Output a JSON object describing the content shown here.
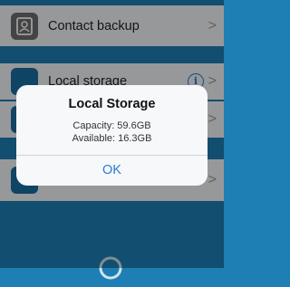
{
  "list": {
    "items": [
      {
        "label": "Contact backup",
        "icon": "contact-book-icon"
      },
      {
        "label": "Local storage",
        "icon": "folder-icon"
      },
      {
        "label": "",
        "icon": "shield-icon"
      },
      {
        "label": "",
        "icon": "checkbox-icon"
      }
    ],
    "info_glyph": "i",
    "chevron": ">"
  },
  "dialog": {
    "title": "Local Storage",
    "capacity": "Capacity: 59.6GB",
    "available": "Available: 16.3GB",
    "ok_label": "OK"
  },
  "colors": {
    "background": "#1d7fb3",
    "row": "#f4f6f8",
    "accent": "#2a7ad6"
  }
}
